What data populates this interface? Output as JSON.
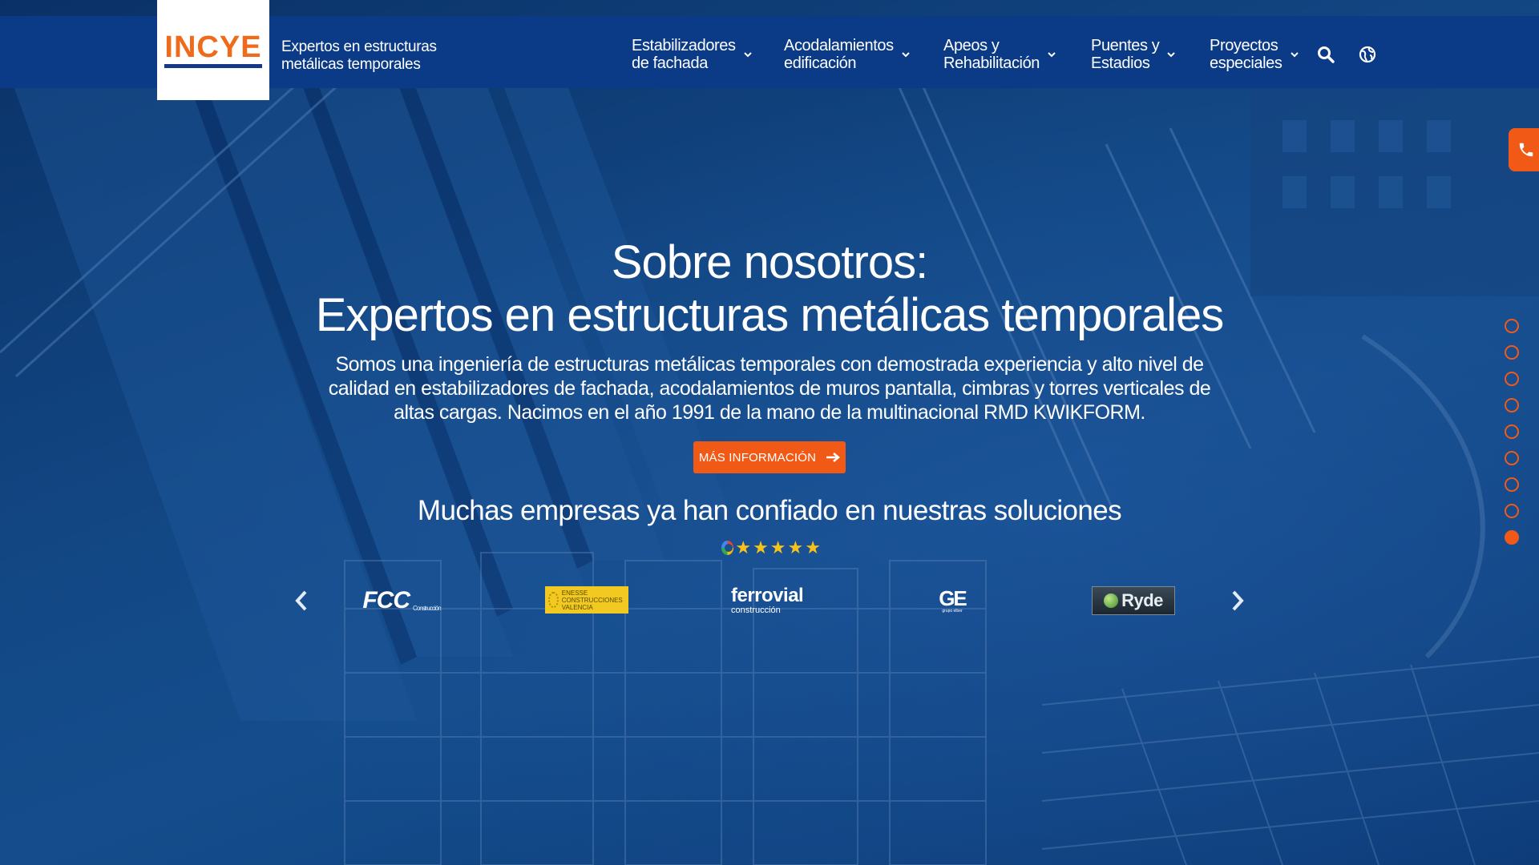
{
  "brand": {
    "logo_text": "INCYE",
    "tagline": "Expertos en estructuras metálicas temporales",
    "primary_color": "#0b3a86",
    "accent_color": "#f15a16"
  },
  "nav": {
    "items": [
      {
        "label": "Estabilizadores\nde fachada"
      },
      {
        "label": "Acodalamientos\nedificación"
      },
      {
        "label": "Apeos y\nRehabilitación"
      },
      {
        "label": "Puentes y\nEstadios"
      },
      {
        "label": "Proyectos\nespeciales"
      }
    ],
    "icons": [
      "search-icon",
      "globe-icon"
    ]
  },
  "hero": {
    "title_line1": "Sobre nosotros:",
    "title_line2": "Expertos en estructuras metálicas temporales",
    "description": "Somos una ingeniería de estructuras metálicas temporales con demostrada experiencia y alto nivel de calidad en estabilizadores de fachada, acodalamientos de muros pantalla, cimbras y torres verticales de altas cargas. Nacimos en el año 1991 de la mano de la multinacional RMD KWIKFORM.",
    "cta_label": "MÁS INFORMACIÓN",
    "trust_text": "Muchas empresas ya han confiado en nuestras soluciones",
    "rating_stars": 5
  },
  "clients": {
    "fcc": {
      "name": "FCC",
      "sub": "Construcción"
    },
    "enesse": {
      "name": "ENESSE CONSTRUCCIONES VALENCIA"
    },
    "ferrovial": {
      "name": "ferrovial",
      "sub": "construcción"
    },
    "ge": {
      "name": "GE",
      "sub": "grupo elber"
    },
    "ryde": {
      "name": "Ryde"
    }
  },
  "section_nav": {
    "total": 9,
    "active_index": 8
  }
}
